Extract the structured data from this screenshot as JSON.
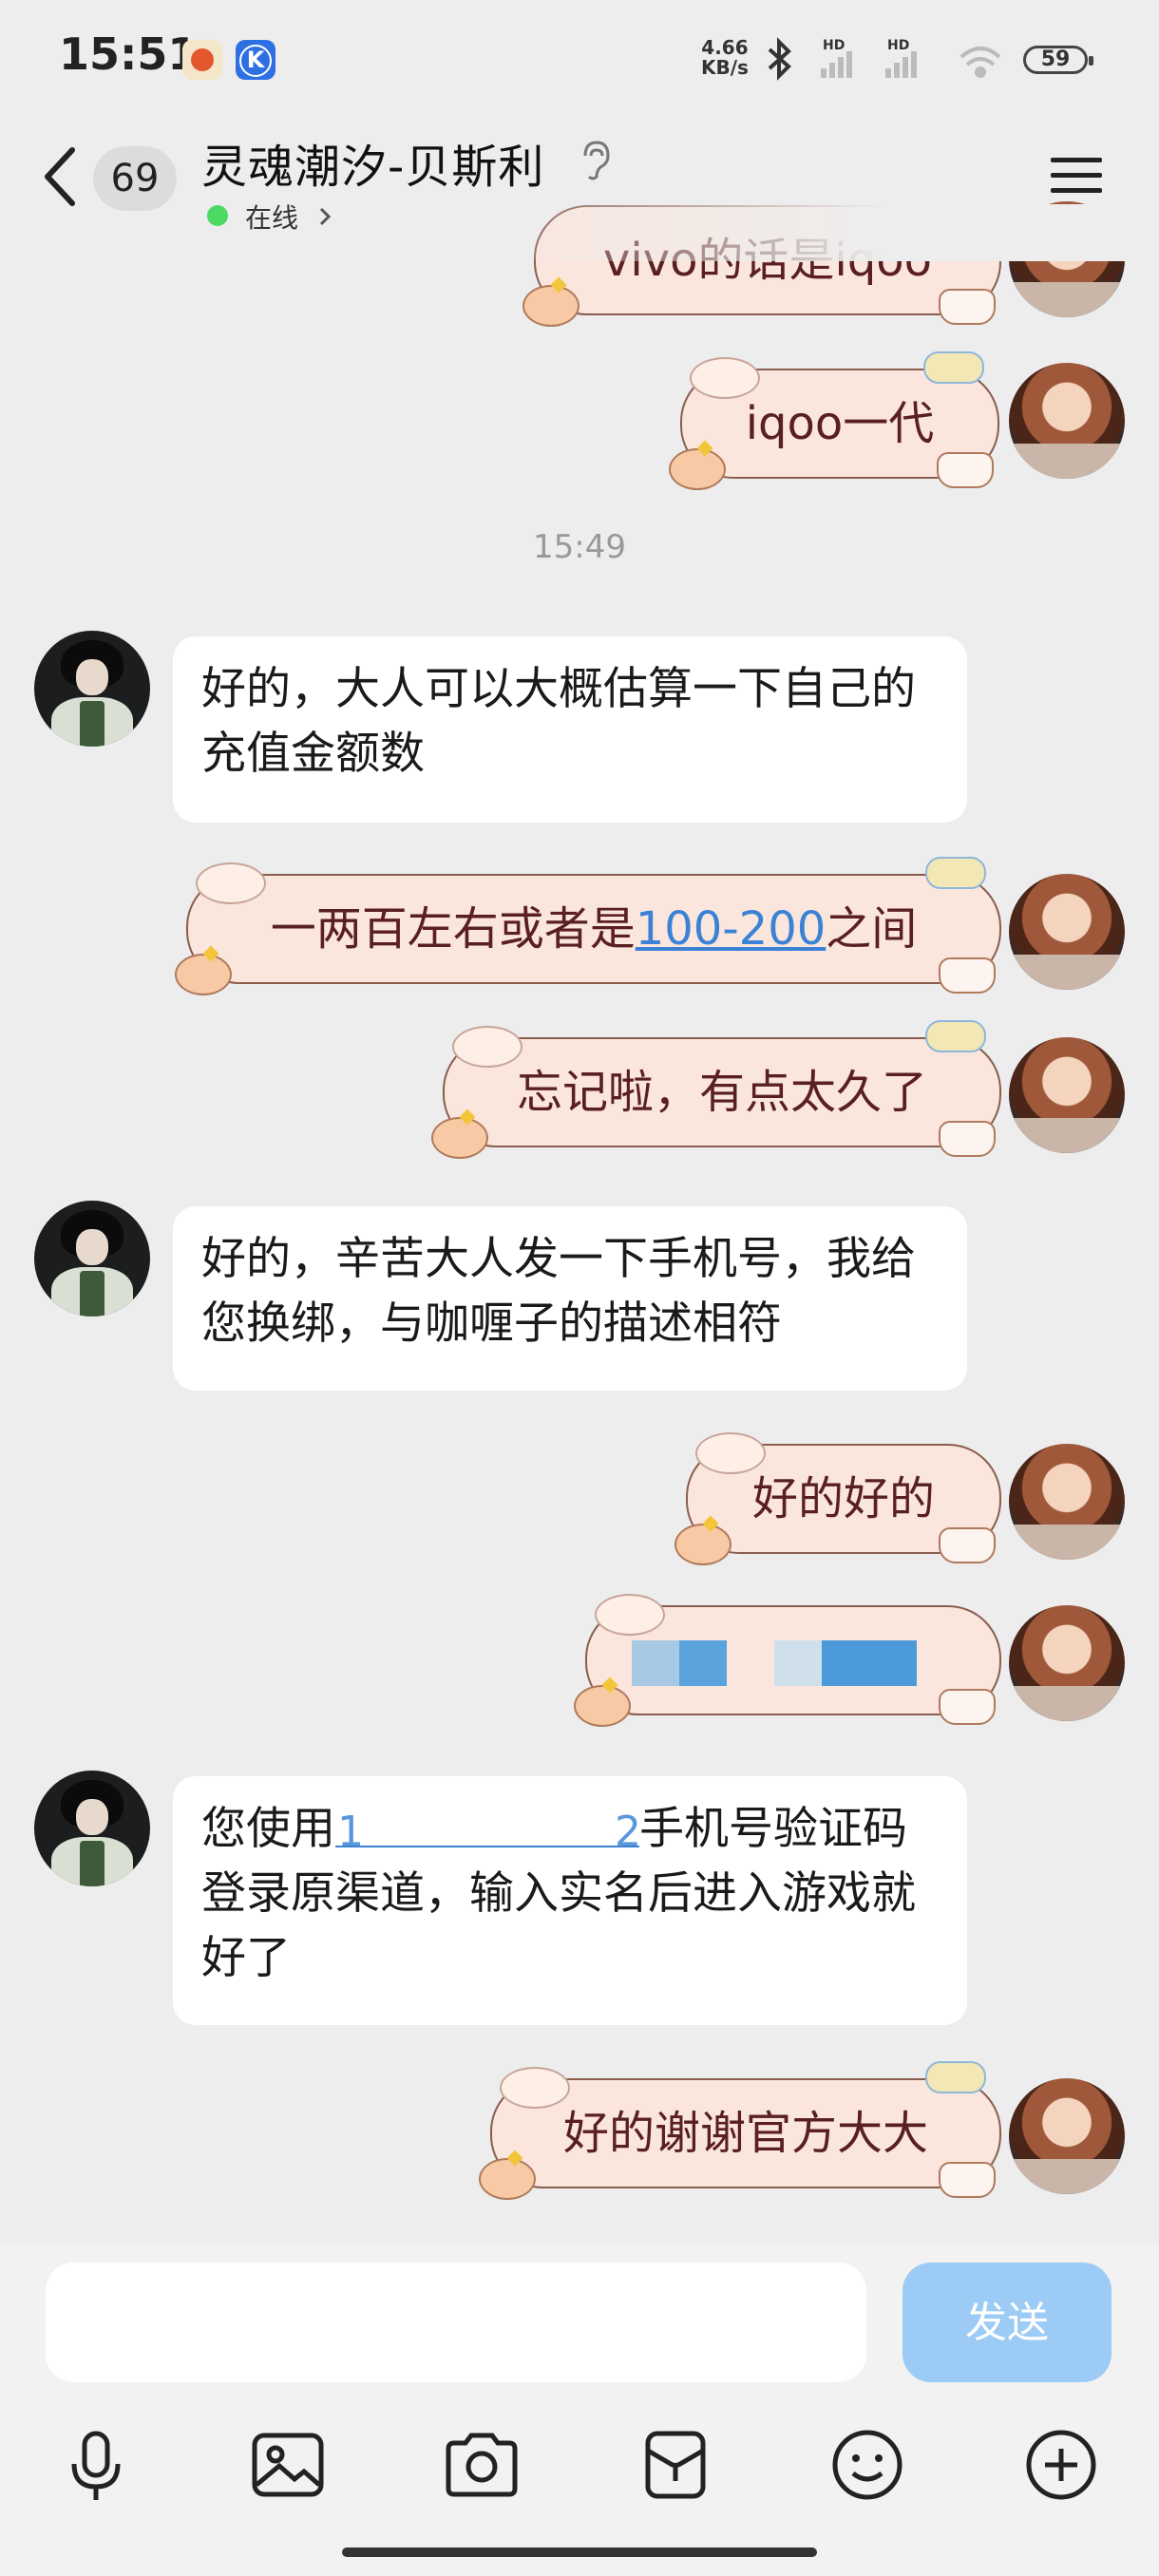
{
  "status_bar": {
    "time": "15:51",
    "net_speed_value": "4.66",
    "net_speed_unit": "KB/s",
    "signal_1_label": "HD",
    "signal_2_label": "HD",
    "battery": "59"
  },
  "header": {
    "unread_count": "69",
    "title": "灵魂潮汐-贝斯利",
    "status": "在线"
  },
  "messages": {
    "m0": "vivo的话是iqoo",
    "m1": "iqoo一代",
    "timestamp": "15:49",
    "m2": "好的，大人可以大概估算一下自己的充值金额数",
    "m3_pre": "一两百左右或者是",
    "m3_link": "100-200",
    "m3_post": "之间",
    "m4": "忘记啦，有点太久了",
    "m5": "好的，辛苦大人发一下手机号，我给您换绑，与咖喱子的描述相符",
    "m6": "好的好的",
    "m8_pre": "您使用",
    "m8_link_start": "1",
    "m8_link_end": "2",
    "m8_post": "手机号验证码登录原渠道，输入实名后进入游戏就好了",
    "m9": "好的谢谢官方大大"
  },
  "composer": {
    "placeholder": "",
    "send_label": "发送"
  },
  "colors": {
    "out_bubble_bg": "#fae6dd",
    "out_text": "#5a1f1f",
    "link": "#3b82d6",
    "send_button": "#9ccbf5",
    "online": "#4cd964"
  },
  "icons": [
    "back-arrow-icon",
    "ear-icon",
    "chevron-right-icon",
    "menu-icon",
    "mic-icon",
    "image-icon",
    "camera-icon",
    "wallet-icon",
    "emoji-icon",
    "plus-icon"
  ]
}
